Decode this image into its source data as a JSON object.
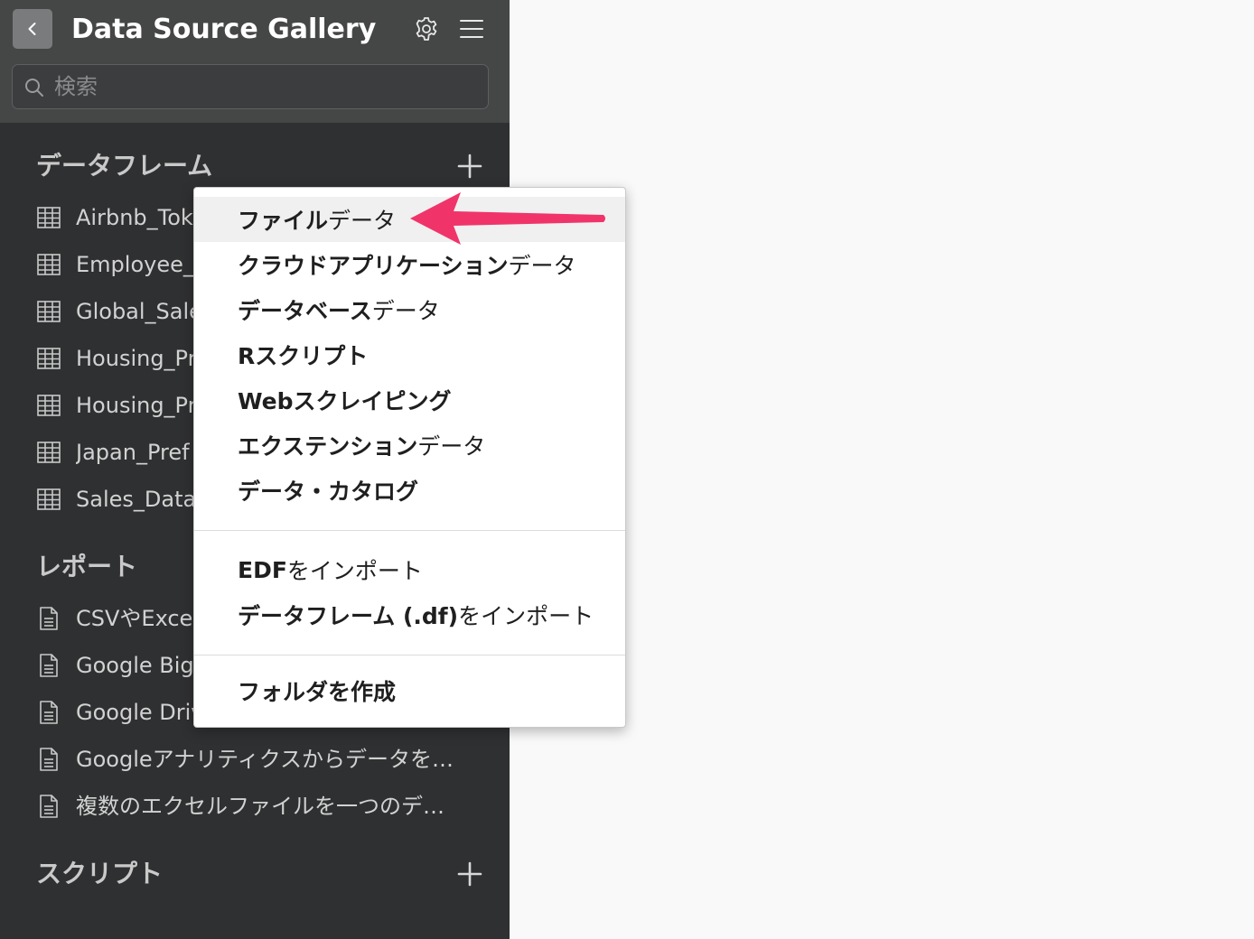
{
  "header": {
    "title": "Data Source Gallery",
    "back_icon": "chevron-left-icon",
    "settings_icon": "gear-icon",
    "menu_icon": "hamburger-icon"
  },
  "search": {
    "placeholder": "検索",
    "value": ""
  },
  "sections": {
    "dataframes": {
      "title": "データフレーム",
      "items": [
        {
          "label": "Airbnb_Tok"
        },
        {
          "label": "Employee_"
        },
        {
          "label": "Global_Sale"
        },
        {
          "label": "Housing_Pr"
        },
        {
          "label": "Housing_Pr"
        },
        {
          "label": "Japan_Pref"
        },
        {
          "label": "Sales_Data"
        }
      ]
    },
    "reports": {
      "title": "レポート",
      "items": [
        {
          "label": "CSVやExce"
        },
        {
          "label": "Google Big"
        },
        {
          "label": "Google Driv"
        },
        {
          "label": "Googleアナリティクスからデータを…"
        },
        {
          "label": "複数のエクセルファイルを一つのデ…"
        }
      ]
    },
    "scripts": {
      "title": "スクリプト"
    }
  },
  "dropdown": {
    "items": [
      {
        "bold": "ファイル",
        "light": "データ"
      },
      {
        "bold": "クラウドアプリケーション",
        "light": "データ"
      },
      {
        "bold": "データベース",
        "light": "データ"
      },
      {
        "bold": "Rスクリプト",
        "light": ""
      },
      {
        "bold": "Webスクレイピング",
        "light": ""
      },
      {
        "bold": "エクステンション",
        "light": "データ"
      },
      {
        "bold": "データ・カタログ",
        "light": ""
      },
      {
        "bold": "EDF",
        "light": "をインポート"
      },
      {
        "bold": "データフレーム (.df)",
        "light": "をインポート"
      },
      {
        "bold": "フォルダを作成",
        "light": ""
      }
    ]
  },
  "colors": {
    "sidebar_bg": "#2f3031",
    "topbar_bg": "#454646",
    "annotation_arrow": "#f0346a"
  }
}
